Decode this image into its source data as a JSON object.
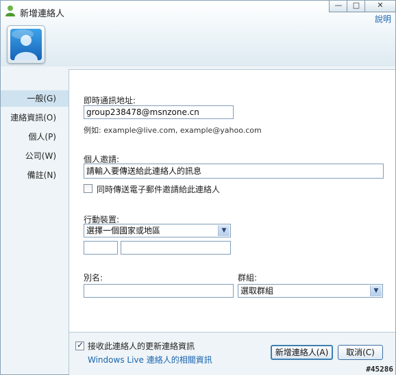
{
  "window": {
    "title": "新增連絡人",
    "help_link": "說明",
    "minimize_glyph": "—",
    "maximize_glyph": "□",
    "close_glyph": "✕",
    "app_icon": "msn-contact-icon",
    "avatar_icon": "user-avatar-icon"
  },
  "sidebar": {
    "items": [
      {
        "label": "一般(G)",
        "selected": true
      },
      {
        "label": "連絡資訊(O)",
        "selected": false
      },
      {
        "label": "個人(P)",
        "selected": false
      },
      {
        "label": "公司(W)",
        "selected": false
      },
      {
        "label": "備註(N)",
        "selected": false
      }
    ]
  },
  "form": {
    "im_address": {
      "label": "即時通訊地址:",
      "value": "group238478@msnzone.cn",
      "example": "例如: example@live.com, example@yahoo.com"
    },
    "invitation": {
      "label": "個人邀請:",
      "value": "請輸入要傳送給此連絡人的訊息",
      "email_checkbox_label": "同時傳送電子郵件邀請給此連絡人",
      "email_checkbox_checked": false
    },
    "mobile": {
      "label": "行動裝置:",
      "country_select": "選擇一個國家或地區",
      "area_code": "",
      "number": ""
    },
    "nickname": {
      "label": "別名:",
      "value": ""
    },
    "group": {
      "label": "群組:",
      "select": "選取群組"
    }
  },
  "footer": {
    "updates_checkbox_label": "接收此連絡人的更新連絡資訊",
    "updates_checkbox_checked": true,
    "info_link": "Windows Live 連絡人的相關資訊",
    "add_button": "新增連絡人(A)",
    "cancel_button": "取消(C)"
  },
  "watermark": "#45286"
}
